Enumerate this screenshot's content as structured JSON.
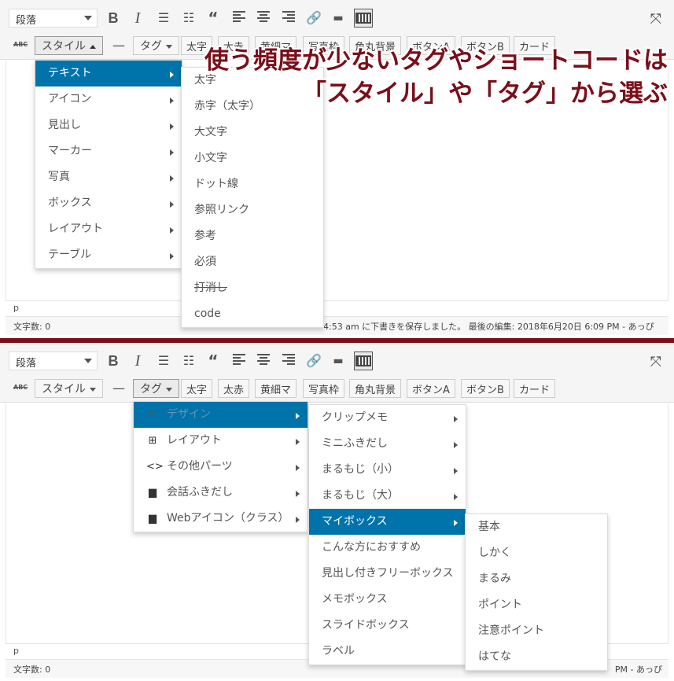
{
  "annotation": {
    "line1": "使う頻度が少ないタグやショートコードは",
    "line2": "「スタイル」や「タグ」から選ぶ",
    "color": "#7a0f1a"
  },
  "toolbar": {
    "format_select": "段落",
    "abc_label": "ABC",
    "style_button": "スタイル",
    "tag_button": "タグ",
    "hr_label": "—",
    "quicktags": [
      "太字",
      "太赤",
      "黄細マ",
      "写真枠",
      "角丸背景",
      "ボタンA",
      "ボタンB",
      "カード"
    ],
    "icons": [
      "bold-icon",
      "italic-icon",
      "bullet-list-icon",
      "numbered-list-icon",
      "blockquote-icon",
      "align-left-icon",
      "align-center-icon",
      "align-right-icon",
      "link-icon",
      "read-more-icon",
      "keyboard-icon",
      "fullscreen-icon"
    ]
  },
  "top": {
    "style_menu": [
      "テキスト",
      "アイコン",
      "見出し",
      "マーカー",
      "写真",
      "ボックス",
      "レイアウト",
      "テーブル"
    ],
    "text_submenu": [
      "太字",
      "赤字（太字）",
      "大文字",
      "小文字",
      "ドット線",
      "参照リンク",
      "参考",
      "必須",
      "打消し",
      "code"
    ],
    "path": "p",
    "word_count": "文字数: 0",
    "status": "4:53 am に下書きを保存しました。 最後の編集: 2018年6月20日 6:09 PM - あっぴ"
  },
  "bottom": {
    "tag_menu": [
      "デザイン",
      "レイアウト",
      "その他パーツ",
      "会話ふきだし",
      "Webアイコン（クラス）"
    ],
    "design_submenu": [
      "クリップメモ",
      "ミニふきだし",
      "まるもじ（小）",
      "まるもじ（大）",
      "マイボックス",
      "こんな方におすすめ",
      "見出し付きフリーボックス",
      "メモボックス",
      "スライドボックス",
      "ラベル"
    ],
    "mybox_submenu": [
      "基本",
      "しかく",
      "まるみ",
      "ポイント",
      "注意ポイント",
      "はてな"
    ],
    "path": "p",
    "word_count": "文字数: 0",
    "status": "PM - あっぴ"
  },
  "colors": {
    "accent": "#0073aa",
    "separator": "#7a0f1a"
  }
}
